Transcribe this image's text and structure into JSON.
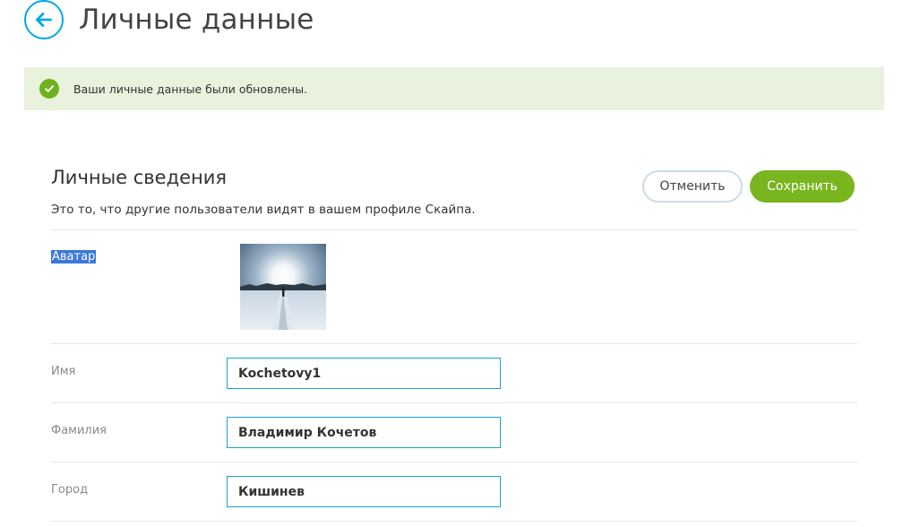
{
  "header": {
    "title": "Личные данные",
    "back_icon": "arrow-left-icon"
  },
  "notice": {
    "message": "Ваши личные данные были обновлены.",
    "icon": "check-circle-icon",
    "color": "#6fb21f",
    "background": "#e8f2dc"
  },
  "section": {
    "title": "Личные сведения",
    "subtitle": "Это то, что другие пользователи видят в вашем профиле Скайпа.",
    "cancel_label": "Отменить",
    "save_label": "Сохранить"
  },
  "fields": {
    "avatar_label": "Аватар",
    "first_name_label": "Имя",
    "first_name_value": "Kochetovy1",
    "last_name_label": "Фамилия",
    "last_name_value": "Владимир Кочетов",
    "city_label": "Город",
    "city_value": "Кишинев"
  },
  "colors": {
    "accent": "#00a8e0",
    "save_button": "#78b51e",
    "input_border": "#1aa3d3"
  }
}
